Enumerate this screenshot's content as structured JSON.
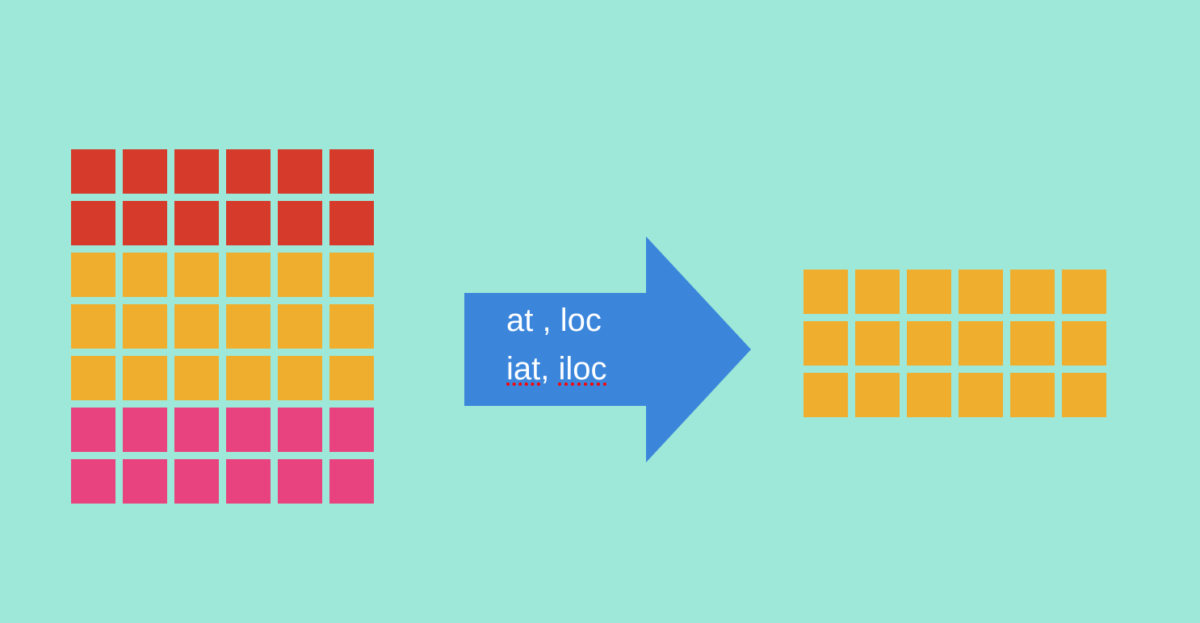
{
  "arrow": {
    "line1_a": "at",
    "line1_sep": " , ",
    "line1_b": "loc",
    "line2_a": "iat",
    "line2_sep": ", ",
    "line2_b": "iloc"
  },
  "colors": {
    "bg": "#9DE8D8",
    "red": "#D63A2A",
    "orange": "#F0AE2F",
    "pink": "#E8427F",
    "arrow": "#3B86DB",
    "text": "#FFFFFF"
  },
  "left_grid": {
    "cols": 6,
    "row_colors": [
      "red",
      "red",
      "orange",
      "orange",
      "orange",
      "pink",
      "pink"
    ]
  },
  "right_grid": {
    "cols": 6,
    "row_colors": [
      "orange",
      "orange",
      "orange"
    ]
  }
}
